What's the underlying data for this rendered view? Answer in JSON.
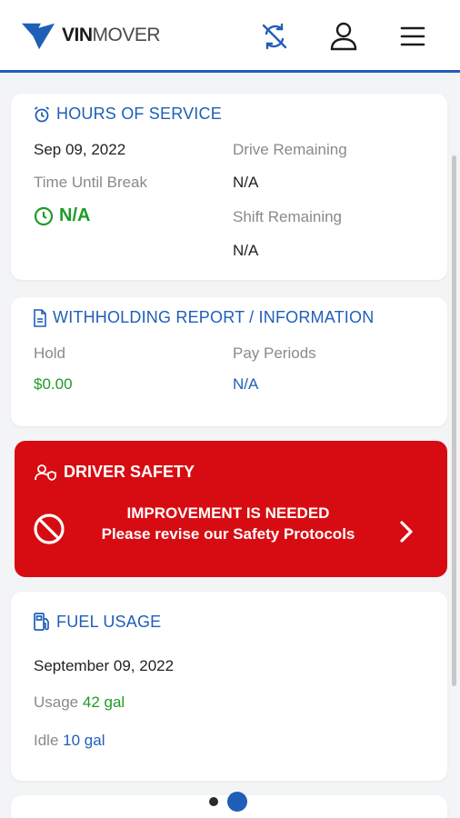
{
  "app": {
    "logo_bold": "VIN",
    "logo_rest": "MOVER"
  },
  "header_icons": [
    "sync-off-icon",
    "user-icon",
    "menu-icon"
  ],
  "hours_of_service": {
    "title": "HOURS OF SERVICE",
    "date": "Sep 09, 2022",
    "time_until_break_label": "Time Until Break",
    "time_until_break_value": "N/A",
    "drive_remaining_label": "Drive Remaining",
    "drive_remaining_value": "N/A",
    "shift_remaining_label": "Shift Remaining",
    "shift_remaining_value": "N/A"
  },
  "withholding": {
    "title": "WITHHOLDING REPORT / INFORMATION",
    "hold_label": "Hold",
    "hold_value": "$0.00",
    "pay_periods_label": "Pay Periods",
    "pay_periods_value": "N/A"
  },
  "driver_safety": {
    "title": "DRIVER SAFETY",
    "headline": "IMPROVEMENT IS NEEDED",
    "message": "Please revise our Safety Protocols"
  },
  "fuel_usage": {
    "title": "FUEL USAGE",
    "date": "September 09, 2022",
    "usage_label": "Usage",
    "usage_value": "42 gal",
    "idle_label": "Idle",
    "idle_value": "10 gal"
  },
  "colors": {
    "brand_blue": "#1f5fb8",
    "alert_red": "#d70c12",
    "success_green": "#1f9a2a"
  },
  "pagination": {
    "current": 2,
    "total": 2
  }
}
